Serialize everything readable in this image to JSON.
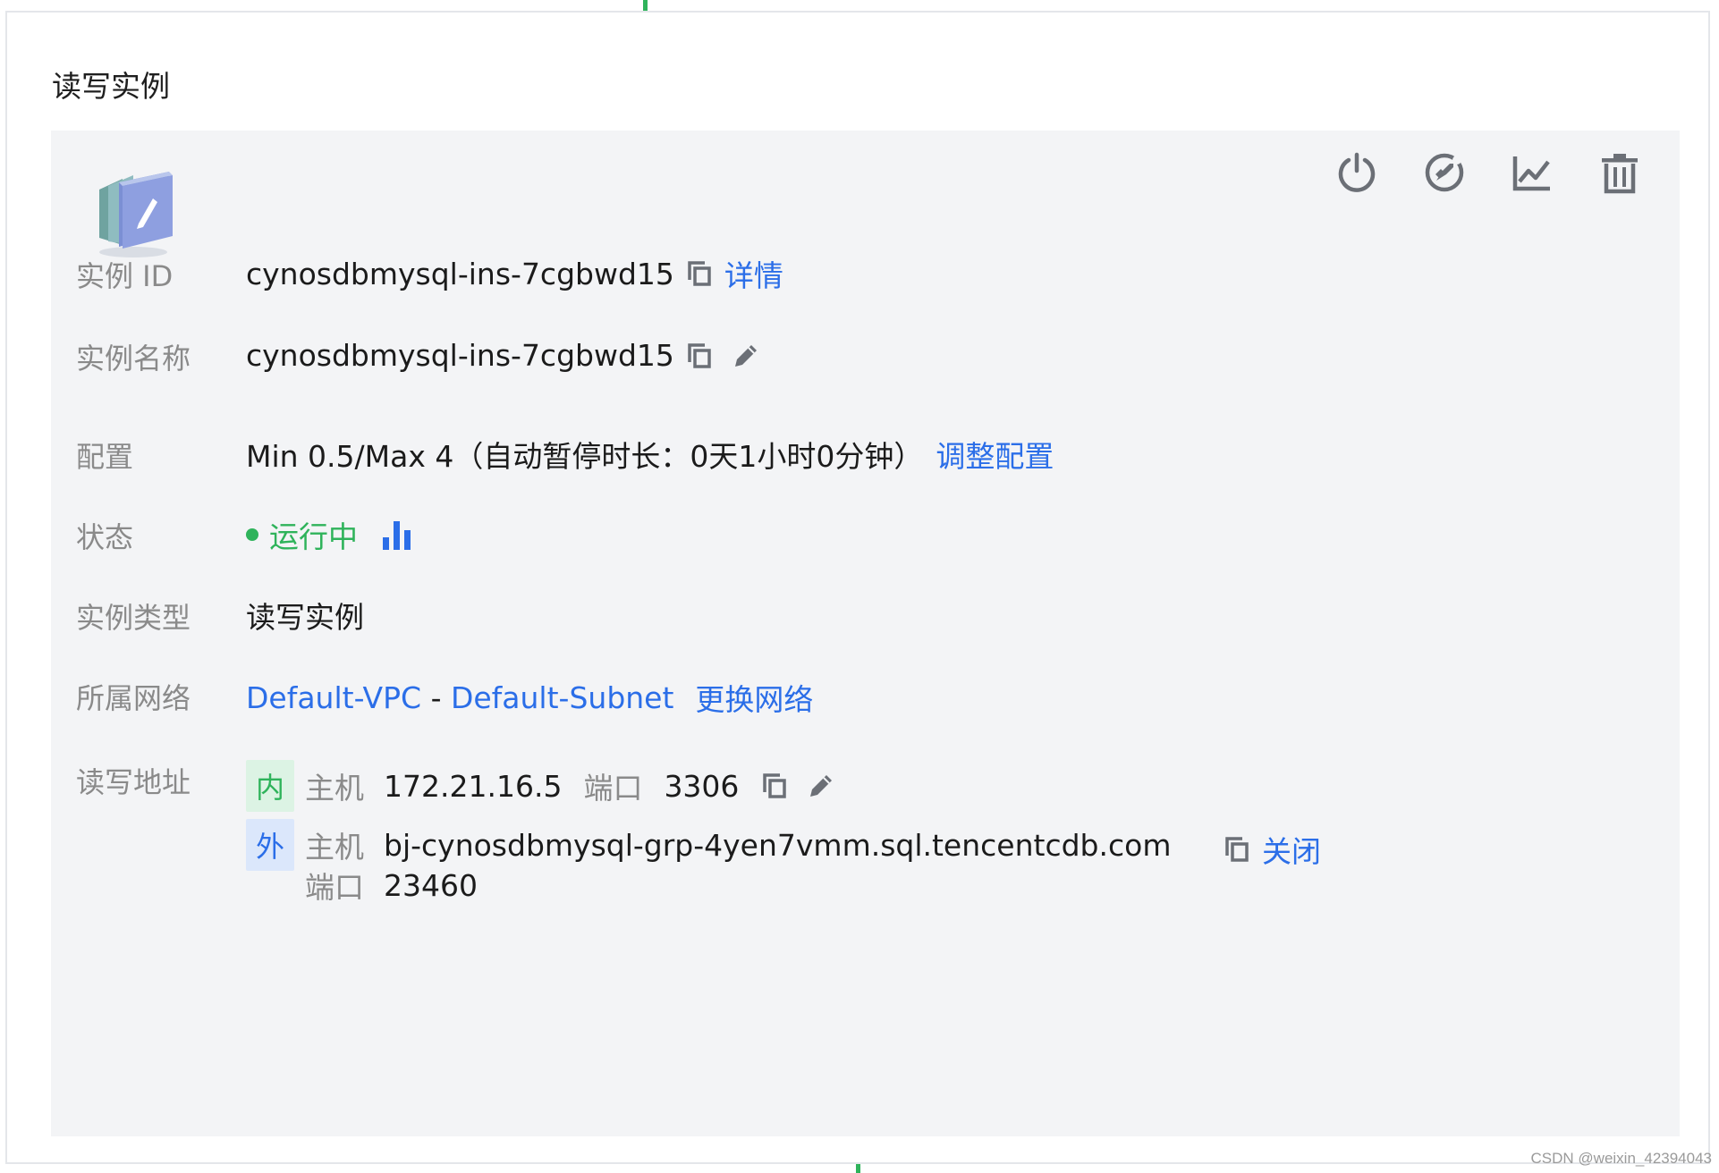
{
  "section_title": "读写实例",
  "instance": {
    "id_label": "实例 ID",
    "id_value": "cynosdbmysql-ins-7cgbwd15",
    "detail_link": "详情",
    "name_label": "实例名称",
    "name_value": "cynosdbmysql-ins-7cgbwd15",
    "config_label": "配置",
    "config_value": "Min 0.5/Max 4（自动暂停时长：0天1小时0分钟）",
    "config_link": "调整配置",
    "status_label": "状态",
    "status_value": "运行中",
    "type_label": "实例类型",
    "type_value": "读写实例",
    "network_label": "所属网络",
    "vpc": "Default-VPC",
    "separator": " - ",
    "subnet": "Default-Subnet",
    "change_network_link": "更换网络",
    "address_label": "读写地址",
    "inner": {
      "tag": "内",
      "host_label": "主机",
      "host": "172.21.16.5",
      "port_label": "端口",
      "port": "3306"
    },
    "outer": {
      "tag": "外",
      "host_label": "主机",
      "host": "bj-cynosdbmysql-grp-4yen7vmm.sql.tencentcdb.com",
      "port_label": "端口",
      "port": "23460",
      "close_link": "关闭"
    }
  },
  "toolbar_icons": [
    "power-icon",
    "rocket-icon",
    "line-chart-icon",
    "trash-icon"
  ],
  "colors": {
    "link": "#2b6ee8",
    "running": "#2fb35b",
    "card_bg": "#f3f4f6",
    "label": "#8a8a8a"
  },
  "watermark": "CSDN @weixin_42394043"
}
